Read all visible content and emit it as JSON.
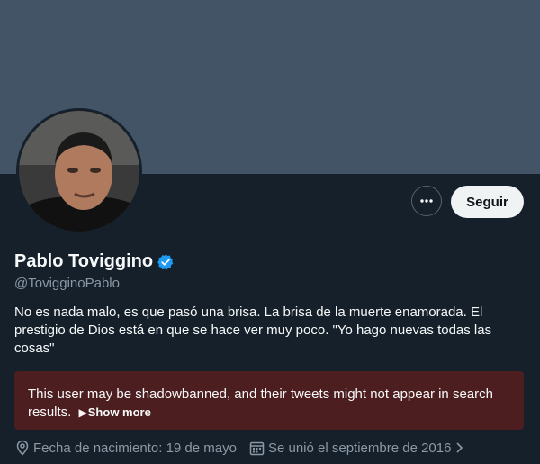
{
  "profile": {
    "name": "Pablo Toviggino",
    "handle": "@TovigginoPablo",
    "bio": "No es nada malo, es que pasó una brisa. La brisa de la muerte enamorada. El prestigio de Dios está en que se hace ver muy poco. \"Yo hago nuevas todas las cosas\"",
    "verified_icon": "verified-badge-icon"
  },
  "actions": {
    "more_icon": "more-horizontal-icon",
    "follow_label": "Seguir"
  },
  "warning": {
    "text": "This user may be shadowbanned, and their tweets might not appear in search results.",
    "show_more_label": "Show more"
  },
  "meta": {
    "birthday": "Fecha de nacimiento: 19 de mayo",
    "joined": "Se unió el septiembre de 2016"
  },
  "colors": {
    "background": "#15202b",
    "banner": "#425466",
    "verified": "#1d9bf0",
    "warning_bg": "#4d1e1f"
  }
}
